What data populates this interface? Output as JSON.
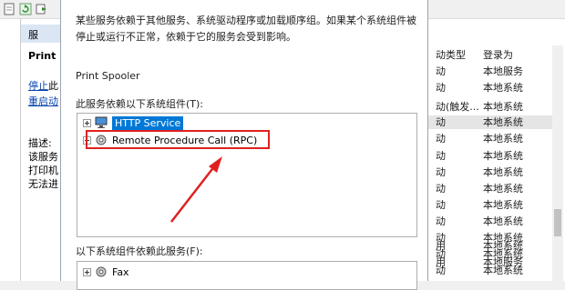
{
  "toolbar": {
    "icons": [
      "doc-icon",
      "refresh-icon",
      "export-icon"
    ]
  },
  "left_panel": {
    "header": "服",
    "title": "Print",
    "link_stop": "停止",
    "link_stop_suffix": "此",
    "link_restart": "重启动",
    "desc_label": "描述:",
    "desc_lines": [
      "该服务",
      "打印机",
      "无法进"
    ]
  },
  "right_panel": {
    "col_startup": "动类型",
    "col_logon": "登录为",
    "rows": [
      {
        "startup": "动",
        "logon": "本地服务"
      },
      {
        "startup": "动",
        "logon": "本地系统"
      },
      {
        "startup": "动(触发...",
        "logon": "本地系统"
      },
      {
        "startup": "动",
        "logon": "本地系统"
      },
      {
        "startup": "动",
        "logon": "本地系统"
      },
      {
        "startup": "动",
        "logon": "本地系统"
      },
      {
        "startup": "动",
        "logon": "本地系统"
      },
      {
        "startup": "动",
        "logon": "本地系统"
      },
      {
        "startup": "动",
        "logon": "本地系统"
      },
      {
        "startup": "动",
        "logon": "本地系统"
      },
      {
        "startup": "动",
        "logon": "本地系统"
      },
      {
        "startup": "动",
        "logon": "本地系统"
      },
      {
        "startup": "用",
        "logon": "本地系统"
      },
      {
        "startup": "动",
        "logon": "本地系统"
      },
      {
        "startup": "用",
        "logon": "本地服务"
      },
      {
        "startup": "动",
        "logon": "本地系统"
      }
    ]
  },
  "dialog": {
    "description": "某些服务依赖于其他服务、系统驱动程序或加载顺序组。如果某个系统组件被停止或运行不正常，依赖于它的服务会受到影响。",
    "service_name": "Print Spooler",
    "depends_on_label": "此服务依赖以下系统组件(T):",
    "depends_on": [
      {
        "name": "HTTP Service",
        "icon": "computer-icon",
        "selected": true
      },
      {
        "name": "Remote Procedure Call (RPC)",
        "icon": "gear-icon",
        "selected": false
      }
    ],
    "dependents_label": "以下系统组件依赖此服务(F):",
    "dependents": [
      {
        "name": "Fax",
        "icon": "gear-icon"
      }
    ]
  },
  "annotation": {
    "color": "#e02020"
  }
}
